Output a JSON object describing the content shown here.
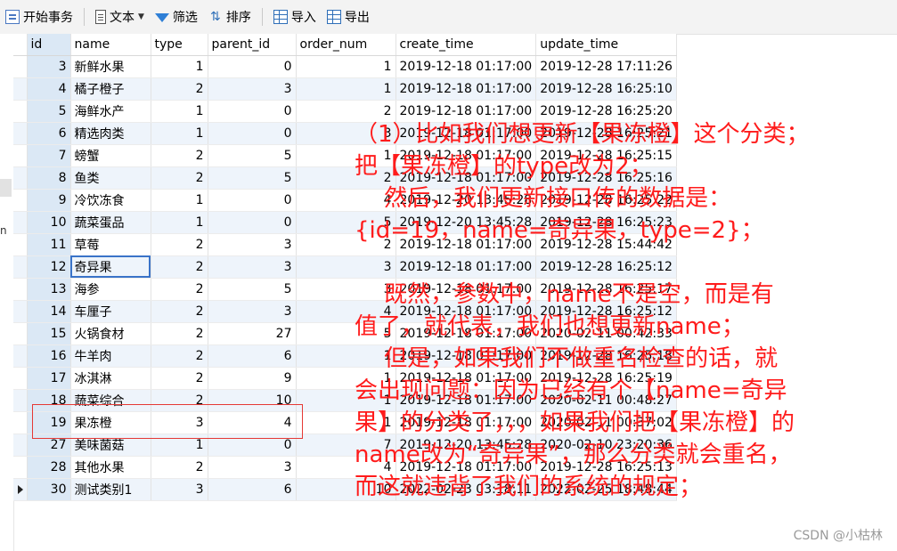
{
  "toolbar": {
    "begin_transaction": "开始事务",
    "text": "文本",
    "filter": "筛选",
    "sort": "排序",
    "import": "导入",
    "export": "导出"
  },
  "left_strip": {
    "letter": "n"
  },
  "columns": [
    "id",
    "name",
    "type",
    "parent_id",
    "order_num",
    "create_time",
    "update_time"
  ],
  "rows": [
    {
      "id": "3",
      "name": "新鲜水果",
      "type": "1",
      "parent_id": "0",
      "order_num": "1",
      "create_time": "2019-12-18 01:17:00",
      "update_time": "2019-12-28 17:11:26"
    },
    {
      "id": "4",
      "name": "橘子橙子",
      "type": "2",
      "parent_id": "3",
      "order_num": "1",
      "create_time": "2019-12-18 01:17:00",
      "update_time": "2019-12-28 16:25:10"
    },
    {
      "id": "5",
      "name": "海鲜水产",
      "type": "1",
      "parent_id": "0",
      "order_num": "2",
      "create_time": "2019-12-18 01:17:00",
      "update_time": "2019-12-28 16:25:20"
    },
    {
      "id": "6",
      "name": "精选肉类",
      "type": "1",
      "parent_id": "0",
      "order_num": "3",
      "create_time": "2019-12-18 01:17:00",
      "update_time": "2019-12-28 16:25:21"
    },
    {
      "id": "7",
      "name": "螃蟹",
      "type": "2",
      "parent_id": "5",
      "order_num": "1",
      "create_time": "2019-12-18 01:17:00",
      "update_time": "2019-12-28 16:25:15"
    },
    {
      "id": "8",
      "name": "鱼类",
      "type": "2",
      "parent_id": "5",
      "order_num": "2",
      "create_time": "2019-12-18 01:17:00",
      "update_time": "2019-12-28 16:25:16"
    },
    {
      "id": "9",
      "name": "冷饮冻食",
      "type": "1",
      "parent_id": "0",
      "order_num": "4",
      "create_time": "2019-12-20 13:45:28",
      "update_time": "2019-12-28 16:25:22"
    },
    {
      "id": "10",
      "name": "蔬菜蛋品",
      "type": "1",
      "parent_id": "0",
      "order_num": "5",
      "create_time": "2019-12-20 13:45:28",
      "update_time": "2019-12-28 16:25:23"
    },
    {
      "id": "11",
      "name": "草莓",
      "type": "2",
      "parent_id": "3",
      "order_num": "2",
      "create_time": "2019-12-18 01:17:00",
      "update_time": "2019-12-28 15:44:42"
    },
    {
      "id": "12",
      "name": "奇异果",
      "type": "2",
      "parent_id": "3",
      "order_num": "3",
      "create_time": "2019-12-18 01:17:00",
      "update_time": "2019-12-28 16:25:12"
    },
    {
      "id": "13",
      "name": "海参",
      "type": "2",
      "parent_id": "5",
      "order_num": "3",
      "create_time": "2019-12-18 01:17:00",
      "update_time": "2019-12-28 16:25:17"
    },
    {
      "id": "14",
      "name": "车厘子",
      "type": "2",
      "parent_id": "3",
      "order_num": "4",
      "create_time": "2019-12-18 01:17:00",
      "update_time": "2019-12-28 16:25:12"
    },
    {
      "id": "15",
      "name": "火锅食材",
      "type": "2",
      "parent_id": "27",
      "order_num": "5",
      "create_time": "2019-12-18 01:17:00",
      "update_time": "2020-02-11 00:42:33"
    },
    {
      "id": "16",
      "name": "牛羊肉",
      "type": "2",
      "parent_id": "6",
      "order_num": "1",
      "create_time": "2019-12-18 01:17:00",
      "update_time": "2019-12-28 16:25:18"
    },
    {
      "id": "17",
      "name": "冰淇淋",
      "type": "2",
      "parent_id": "9",
      "order_num": "1",
      "create_time": "2019-12-18 01:17:00",
      "update_time": "2019-12-28 16:25:19"
    },
    {
      "id": "18",
      "name": "蔬菜综合",
      "type": "2",
      "parent_id": "10",
      "order_num": "1",
      "create_time": "2019-12-18 01:17:00",
      "update_time": "2020-02-11 00:48:27"
    },
    {
      "id": "19",
      "name": "果冻橙",
      "type": "3",
      "parent_id": "4",
      "order_num": "1",
      "create_time": "2019-12-18 01:17:00",
      "update_time": "2020-02-11 00:37:02"
    },
    {
      "id": "27",
      "name": "美味菌菇",
      "type": "1",
      "parent_id": "0",
      "order_num": "7",
      "create_time": "2019-12-20 13:45:28",
      "update_time": "2020-02-10 23:20:36"
    },
    {
      "id": "28",
      "name": "其他水果",
      "type": "2",
      "parent_id": "3",
      "order_num": "4",
      "create_time": "2019-12-18 01:17:00",
      "update_time": "2019-12-28 16:25:13"
    },
    {
      "id": "30",
      "name": "测试类别1",
      "type": "3",
      "parent_id": "6",
      "order_num": "10",
      "create_time": "2022-02-23 03:18:11",
      "update_time": "2022-02-25 18:48:44"
    }
  ],
  "annotation": [
    "（1）比如我们想更新【果冻橙】这个分类；",
    "把【果冻橙】的type改为2；",
    "    然后，我们更新接口传的数据是：",
    "{id=19，name=奇异果，type=2}；",
    "",
    "    既然，参数中，name不是空，而是有",
    "值了，就代表，我们也想更新name；",
    "    但是，如果我们不做重名检查的话，就",
    "会出现问题：因为已经有个【name=奇异",
    "果】的分类了，，，如果我们把【果冻橙】的",
    "name改为“奇异果”，那么分类就会重名，",
    "而这就违背了我们的系统的规定；"
  ],
  "watermark": "CSDN @小枯林"
}
